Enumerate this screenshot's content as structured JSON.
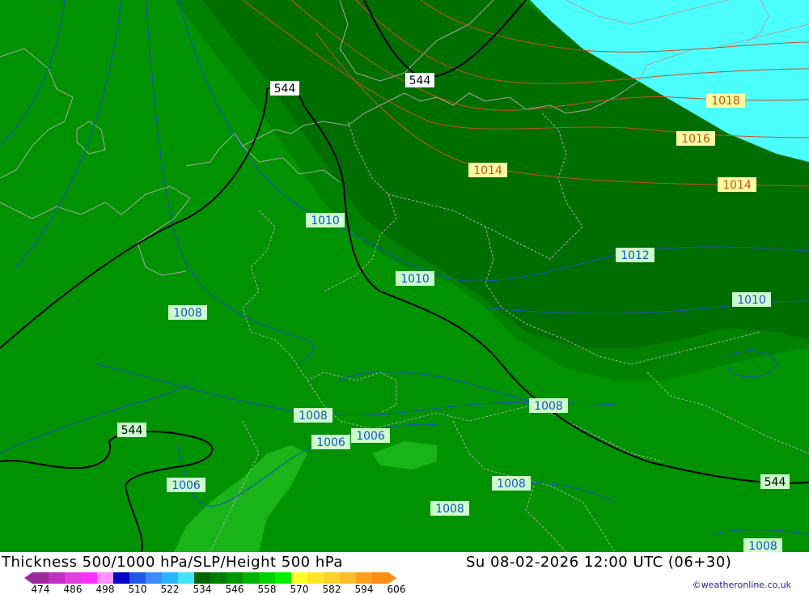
{
  "title": "Thickness 500/1000 hPa/SLP/Height 500 hPa",
  "valid_time": "Su 08-02-2026 12:00 UTC (06+30)",
  "credit": "©weatheronline.co.uk",
  "colors": {
    "land": "#009200",
    "dark_band": "#006e00",
    "mid_band": "#008200",
    "light_patch": "#18b418",
    "sea_north": "#4cffff",
    "borders": "#a8a8a8",
    "isobars_low": "#1e4fc8",
    "isobars_high": "#c85028",
    "height_contours": "#000000"
  },
  "isobar_labels": [
    {
      "text": "1018",
      "type": "high"
    },
    {
      "text": "1016",
      "type": "high"
    },
    {
      "text": "1014",
      "type": "high"
    },
    {
      "text": "1014",
      "type": "high"
    },
    {
      "text": "1012",
      "type": "low"
    },
    {
      "text": "1010",
      "type": "low"
    },
    {
      "text": "1010",
      "type": "low"
    },
    {
      "text": "1010",
      "type": "low"
    },
    {
      "text": "1008",
      "type": "low"
    },
    {
      "text": "1008",
      "type": "low"
    },
    {
      "text": "1008",
      "type": "low"
    },
    {
      "text": "1008",
      "type": "low"
    },
    {
      "text": "1008",
      "type": "low"
    },
    {
      "text": "1008",
      "type": "low"
    },
    {
      "text": "1006",
      "type": "low"
    },
    {
      "text": "1006",
      "type": "low"
    },
    {
      "text": "1006",
      "type": "low"
    }
  ],
  "height_labels": [
    "544",
    "544",
    "544",
    "544"
  ],
  "scale": {
    "colors": [
      "#9a2a9a",
      "#c030c0",
      "#e040e0",
      "#ff30ff",
      "#ff90ff",
      "#0000c8",
      "#1e5ae6",
      "#3c8cff",
      "#28b4ff",
      "#40e6ff",
      "#006400",
      "#007e00",
      "#009600",
      "#00b400",
      "#00d200",
      "#00f000",
      "#ffff28",
      "#ffe628",
      "#ffd228",
      "#ffbe28",
      "#ffa01e",
      "#ff8c14"
    ],
    "ticks": [
      "474",
      "486",
      "498",
      "510",
      "522",
      "534",
      "546",
      "558",
      "570",
      "582",
      "594",
      "606"
    ]
  }
}
